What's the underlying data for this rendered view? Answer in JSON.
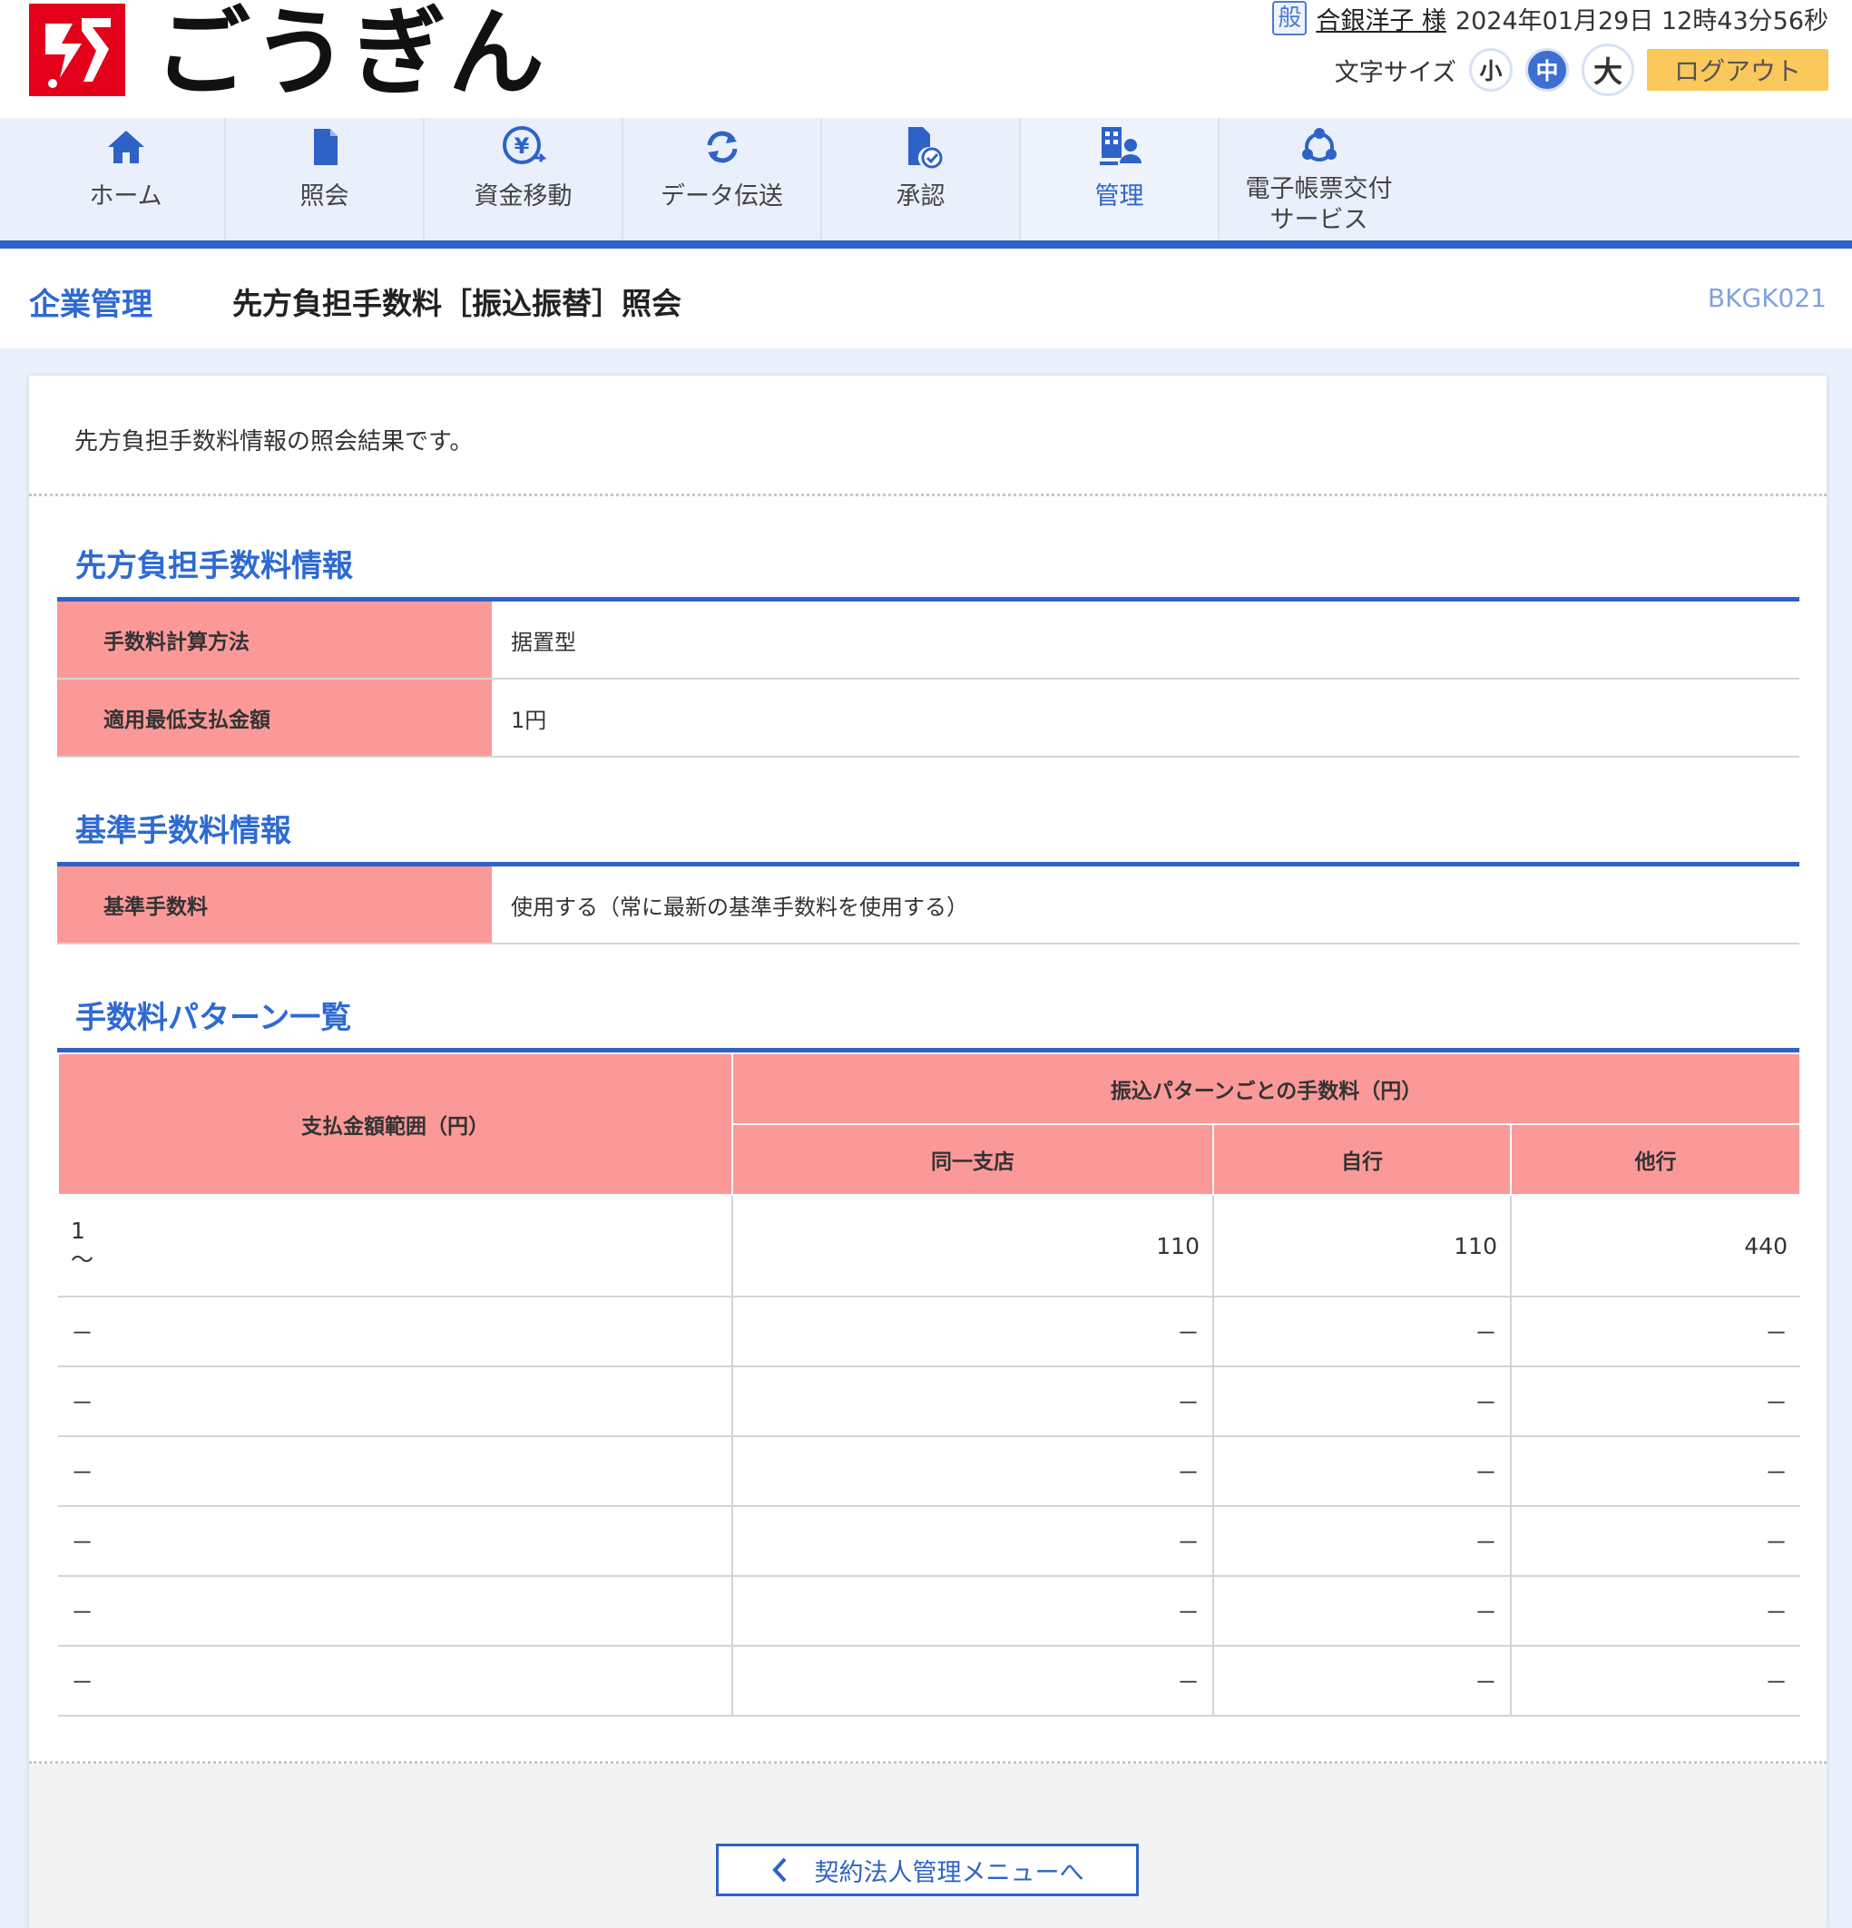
{
  "header": {
    "logo_text": "ごうぎん",
    "user_badge": "般",
    "user_name": "合銀洋子 様",
    "datetime": "2024年01月29日 12時43分56秒",
    "font_size_label": "文字サイズ",
    "font_sizes": [
      "小",
      "中",
      "大"
    ],
    "logout_label": "ログアウト"
  },
  "nav": {
    "items": [
      {
        "label": "ホーム",
        "icon": "home-icon"
      },
      {
        "label": "照会",
        "icon": "document-icon"
      },
      {
        "label": "資金移動",
        "icon": "yen-transfer-icon"
      },
      {
        "label": "データ伝送",
        "icon": "sync-icon"
      },
      {
        "label": "承認",
        "icon": "approval-icon"
      },
      {
        "label": "管理",
        "icon": "admin-icon"
      },
      {
        "label_line1": "電子帳票交付",
        "label_line2": "サービス",
        "icon": "network-icon"
      }
    ],
    "active": "管理"
  },
  "page": {
    "section": "企業管理",
    "title": "先方負担手数料［振込振替］照会",
    "screen_id": "BKGK021"
  },
  "intro": "先方負担手数料情報の照会結果です。",
  "fee_info": {
    "heading": "先方負担手数料情報",
    "rows": [
      {
        "label": "手数料計算方法",
        "value": "据置型"
      },
      {
        "label": "適用最低支払金額",
        "value": "1円"
      }
    ]
  },
  "base_fee": {
    "heading": "基準手数料情報",
    "rows": [
      {
        "label": "基準手数料",
        "value": "使用する（常に最新の基準手数料を使用する）"
      }
    ]
  },
  "pattern_list": {
    "heading": "手数料パターン一覧",
    "headers": {
      "range": "支払金額範囲（円）",
      "group": "振込パターンごとの手数料（円）",
      "same_branch": "同一支店",
      "own_bank": "自行",
      "other_bank": "他行"
    },
    "rows": [
      {
        "range_from": "1",
        "range_to": "～",
        "same_branch": "110",
        "own_bank": "110",
        "other_bank": "440"
      },
      {
        "range": "－",
        "same_branch": "－",
        "own_bank": "－",
        "other_bank": "－"
      },
      {
        "range": "－",
        "same_branch": "－",
        "own_bank": "－",
        "other_bank": "－"
      },
      {
        "range": "－",
        "same_branch": "－",
        "own_bank": "－",
        "other_bank": "－"
      },
      {
        "range": "－",
        "same_branch": "－",
        "own_bank": "－",
        "other_bank": "－"
      },
      {
        "range": "－",
        "same_branch": "－",
        "own_bank": "－",
        "other_bank": "－"
      },
      {
        "range": "－",
        "same_branch": "－",
        "own_bank": "－",
        "other_bank": "－"
      }
    ]
  },
  "footer": {
    "back_label": "契約法人管理メニューへ"
  },
  "colors": {
    "brand_red": "#e2001b",
    "accent_blue": "#2e62c7",
    "header_pink": "#fb9999",
    "logout_yellow": "#fbc85b"
  }
}
